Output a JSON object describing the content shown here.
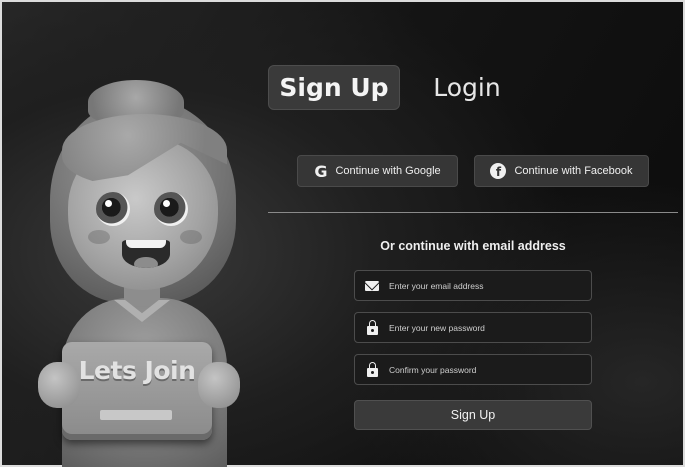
{
  "tabs": {
    "signup": "Sign Up",
    "login": "Login"
  },
  "social": {
    "google": "Continue with Google",
    "facebook": "Continue with Facebook"
  },
  "divider_text": "Or continue with email address",
  "fields": {
    "email": {
      "placeholder": "Enter your email address",
      "value": ""
    },
    "password": {
      "placeholder": "Enter your new password",
      "value": ""
    },
    "confirm": {
      "placeholder": "Confirm your password",
      "value": ""
    }
  },
  "submit_label": "Sign Up",
  "illustration": {
    "sign_text": "Lets Join"
  },
  "icons": {
    "google": "google-icon",
    "facebook": "facebook-icon",
    "email": "mail-icon",
    "password": "lock-icon",
    "confirm": "lock-icon"
  },
  "colors": {
    "background": "#141414",
    "panel_button": "#3a3a3a",
    "input_bg": "#1b1b1b",
    "text": "#f0f0f0"
  }
}
